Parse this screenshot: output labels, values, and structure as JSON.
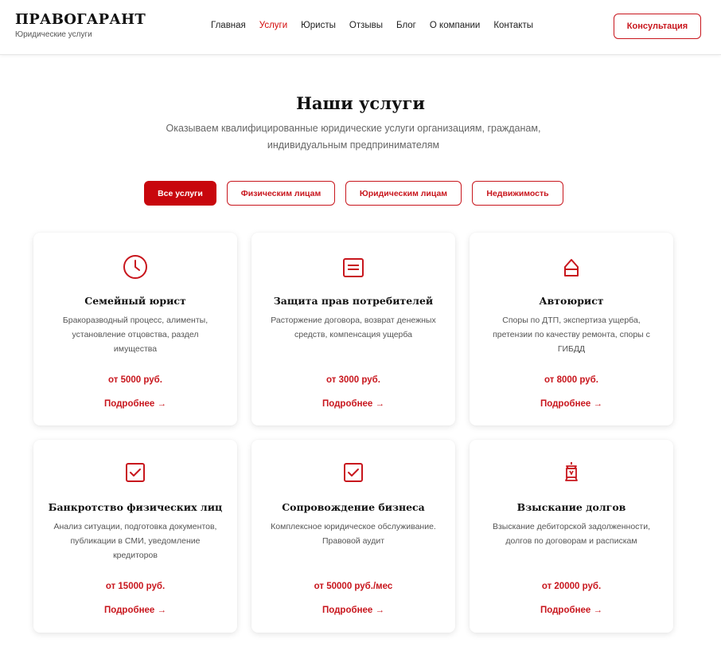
{
  "header": {
    "logo_title": "ПРАВОГАРАНТ",
    "logo_subtitle": "Юридические услуги",
    "nav": [
      "Главная",
      "Услуги",
      "Юристы",
      "Отзывы",
      "Блог",
      "О компании",
      "Контакты"
    ],
    "active_nav": "Услуги",
    "cta_label": "Консультация"
  },
  "section": {
    "title": "Наши услуги",
    "subtitle": "Оказываем квалифицированные юридические услуги организациям, гражданам, индивидуальным предпринимателям"
  },
  "filters": [
    "Все услуги",
    "Физическим лицам",
    "Юридическим лицам",
    "Недвижимость"
  ],
  "active_filter": "Все услуги",
  "cards": [
    {
      "icon": "clock-icon",
      "title": "Семейный юрист",
      "description": "Бракоразводный процесс, алименты, установление отцовства, раздел имущества",
      "price": "от 5000 руб.",
      "link": "Подробнее →"
    },
    {
      "icon": "document-icon",
      "title": "Защита прав потребителей",
      "description": "Расторжение договора, возврат денежных средств, компенсация ущерба",
      "price": "от 3000 руб.",
      "link": "Подробнее →"
    },
    {
      "icon": "house-icon",
      "title": "Автоюрист",
      "description": "Споры по ДТП, экспертиза ущерба, претензии по качеству ремонта, споры с ГИБДД",
      "price": "от 8000 руб.",
      "link": "Подробнее →"
    },
    {
      "icon": "checkbox-icon",
      "title": "Банкротство физических лиц",
      "description": "Анализ ситуации, подготовка документов, публикации в СМИ, уведомление кредиторов",
      "price": "от 15000 руб.",
      "link": "Подробнее →"
    },
    {
      "icon": "checkbox-icon",
      "title": "Сопровождение бизнеса",
      "description": "Комплексное юридическое обслуживание. Правовой аудит",
      "price": "от 50000 руб./мес",
      "link": "Подробнее →"
    },
    {
      "icon": "lantern-icon",
      "title": "Взыскание долгов",
      "description": "Взыскание дебиторской задолженности, долгов по договорам и распискам",
      "price": "от 20000 руб.",
      "link": "Подробнее →"
    }
  ],
  "colors": {
    "accent": "#c8161d",
    "accent_fill": "#c8070d",
    "text": "#111111",
    "muted": "#666666"
  }
}
